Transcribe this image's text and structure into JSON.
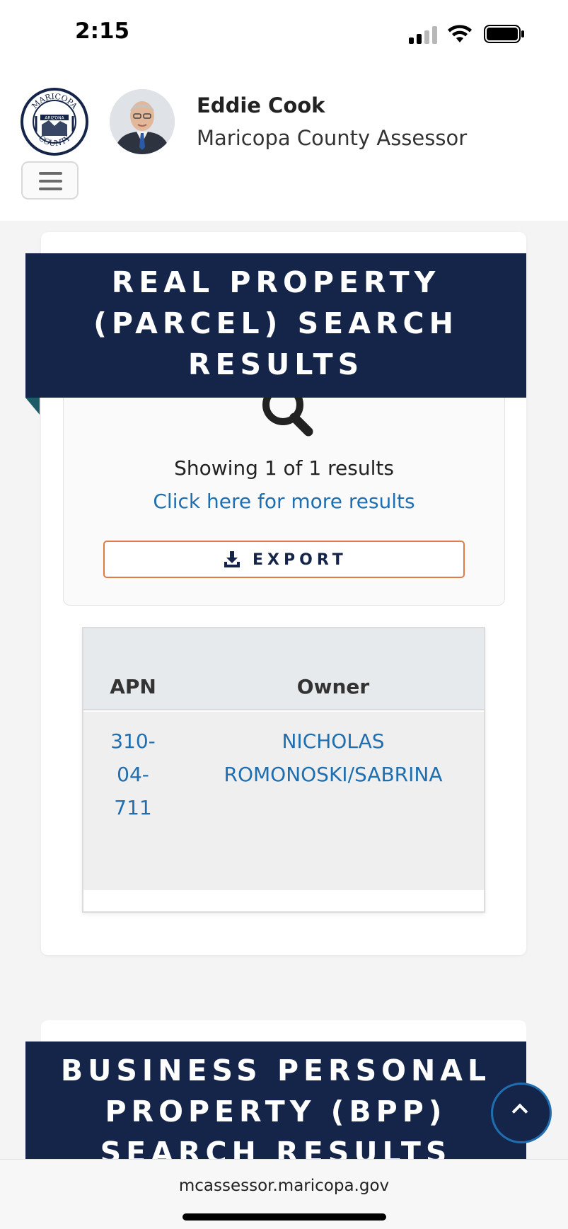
{
  "status_bar": {
    "time": "2:15"
  },
  "header": {
    "seal_text": {
      "top": "MARICOPA",
      "middle": "ARIZONA",
      "bottom": "COUNTY"
    },
    "name": "Eddie Cook",
    "title": "Maricopa County Assessor"
  },
  "real_property": {
    "heading_lines": [
      "REAL PROPERTY",
      "(PARCEL) SEARCH",
      "RESULTS"
    ],
    "showing_text": "Showing 1 of 1 results",
    "more_results_link": "Click here for more results",
    "export_label": "EXPORT",
    "table": {
      "columns": [
        "APN",
        "Owner"
      ],
      "rows": [
        {
          "apn_lines": [
            "310-",
            "04-",
            "711"
          ],
          "owner_lines": [
            "NICHOLAS",
            "ROMONOSKI/SABRINA"
          ]
        }
      ]
    }
  },
  "bpp": {
    "heading_lines": [
      "BUSINESS PERSONAL",
      "PROPERTY (BPP)",
      "SEARCH RESULTS"
    ]
  },
  "browser": {
    "url": "mcassessor.maricopa.gov"
  },
  "colors": {
    "navy": "#15254a",
    "link_blue": "#1f6fb0",
    "export_border": "#e07b45"
  }
}
